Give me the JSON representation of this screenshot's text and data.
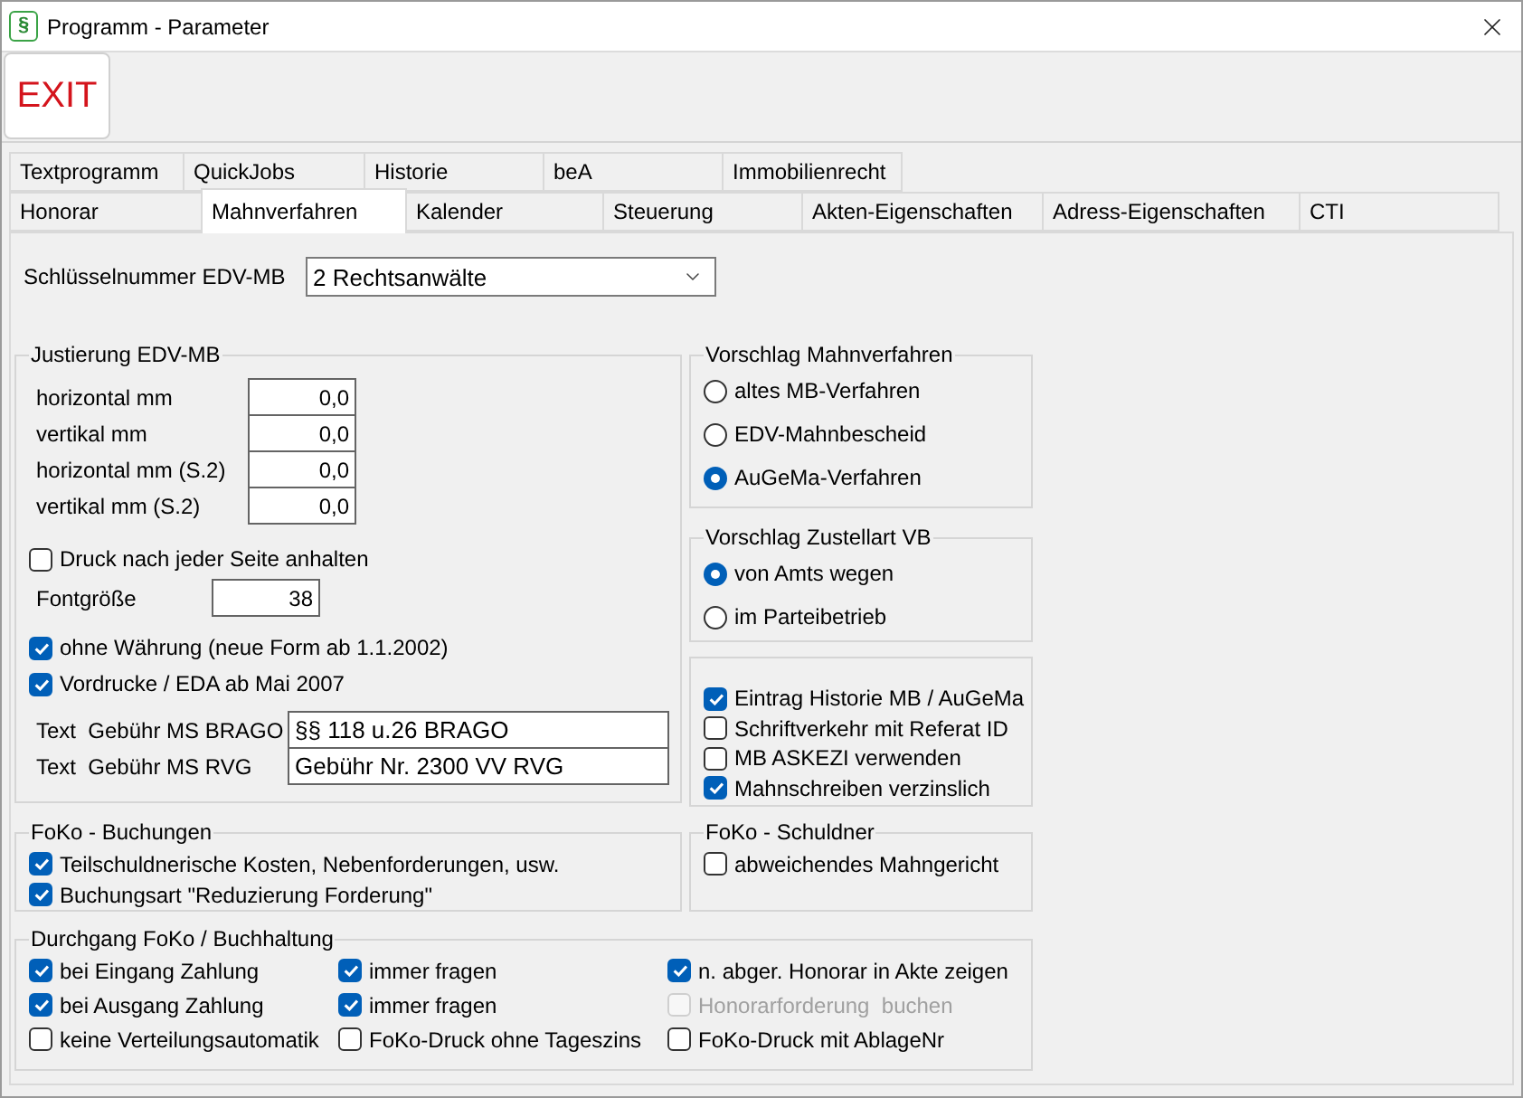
{
  "window": {
    "icon_glyph": "§",
    "title": "Programm - Parameter"
  },
  "toolbar": {
    "exit_label": "EXIT"
  },
  "tab_rows": [
    {
      "tabs": [
        {
          "label": "Textprogramm",
          "selected": false
        },
        {
          "label": "QuickJobs",
          "selected": false
        },
        {
          "label": "Historie",
          "selected": false
        },
        {
          "label": "beA",
          "selected": false
        },
        {
          "label": "Immobilienrecht",
          "selected": false
        }
      ]
    },
    {
      "tabs": [
        {
          "label": "Honorar",
          "selected": false
        },
        {
          "label": "Mahnverfahren",
          "selected": true
        },
        {
          "label": "Kalender",
          "selected": false
        },
        {
          "label": "Steuerung",
          "selected": false
        },
        {
          "label": "Akten-Eigenschaften",
          "selected": false
        },
        {
          "label": "Adress-Eigenschaften",
          "selected": false
        },
        {
          "label": "CTI",
          "selected": false
        }
      ]
    }
  ],
  "schluesselnummer": {
    "label": "Schlüsselnummer EDV-MB",
    "value": "2 Rechtsanwälte"
  },
  "justierung": {
    "title": "Justierung EDV-MB",
    "offsets": [
      {
        "label": "horizontal mm",
        "value": "0,0"
      },
      {
        "label": "vertikal mm",
        "value": "0,0"
      },
      {
        "label": "horizontal mm (S.2)",
        "value": "0,0"
      },
      {
        "label": "vertikal mm (S.2)",
        "value": "0,0"
      }
    ],
    "pause_checkbox": {
      "label": "Druck nach jeder Seite anhalten",
      "checked": false
    },
    "font_size": {
      "label": "Fontgröße",
      "value": "38"
    },
    "form_checkboxes": [
      {
        "label": "ohne Währung (neue Form ab 1.1.2002)",
        "checked": true
      },
      {
        "label": "Vordrucke / EDA ab Mai 2007",
        "checked": true
      }
    ],
    "fee_texts": [
      {
        "label": "Text  Gebühr MS BRAGO",
        "value": "§§ 118 u.26 BRAGO"
      },
      {
        "label": "Text  Gebühr MS RVG",
        "value": "Gebühr Nr. 2300 VV RVG"
      }
    ]
  },
  "vorschlag_mahnverfahren": {
    "title": "Vorschlag Mahnverfahren",
    "options": [
      {
        "label": "altes MB-Verfahren",
        "selected": false
      },
      {
        "label": "EDV-Mahnbescheid",
        "selected": false
      },
      {
        "label": "AuGeMa-Verfahren",
        "selected": true
      }
    ]
  },
  "vorschlag_zustellart": {
    "title": "Vorschlag Zustellart VB",
    "options": [
      {
        "label": "von Amts wegen",
        "selected": true
      },
      {
        "label": "im Parteibetrieb",
        "selected": false
      }
    ]
  },
  "mb_options": {
    "checkboxes": [
      {
        "label": "Eintrag Historie MB / AuGeMa",
        "checked": true
      },
      {
        "label": "Schriftverkehr mit Referat ID",
        "checked": false
      },
      {
        "label": "MB ASKEZI verwenden",
        "checked": false
      },
      {
        "label": "Mahnschreiben verzinslich",
        "checked": true
      }
    ]
  },
  "foko_buchungen": {
    "title": "FoKo - Buchungen",
    "checkboxes": [
      {
        "label": "Teilschuldnerische Kosten, Nebenforderungen, usw.",
        "checked": true
      },
      {
        "label": "Buchungsart \"Reduzierung Forderung\"",
        "checked": true
      }
    ]
  },
  "foko_schuldner": {
    "title": "FoKo - Schuldner",
    "checkboxes": [
      {
        "label": "abweichendes Mahngericht",
        "checked": false
      }
    ]
  },
  "durchgang": {
    "title": "Durchgang FoKo / Buchhaltung",
    "checkboxes": [
      {
        "label": "bei Eingang Zahlung",
        "checked": true,
        "disabled": false
      },
      {
        "label": "immer fragen",
        "checked": true,
        "disabled": false
      },
      {
        "label": "n. abger. Honorar in Akte zeigen",
        "checked": true,
        "disabled": false
      },
      {
        "label": "bei Ausgang Zahlung",
        "checked": true,
        "disabled": false
      },
      {
        "label": "immer fragen",
        "checked": true,
        "disabled": false
      },
      {
        "label": "Honorarforderung  buchen",
        "checked": false,
        "disabled": true
      },
      {
        "label": "keine Verteilungsautomatik",
        "checked": false,
        "disabled": false
      },
      {
        "label": "FoKo-Druck ohne Tageszins",
        "checked": false,
        "disabled": false
      },
      {
        "label": "FoKo-Druck mit AblageNr",
        "checked": false,
        "disabled": false
      }
    ]
  }
}
